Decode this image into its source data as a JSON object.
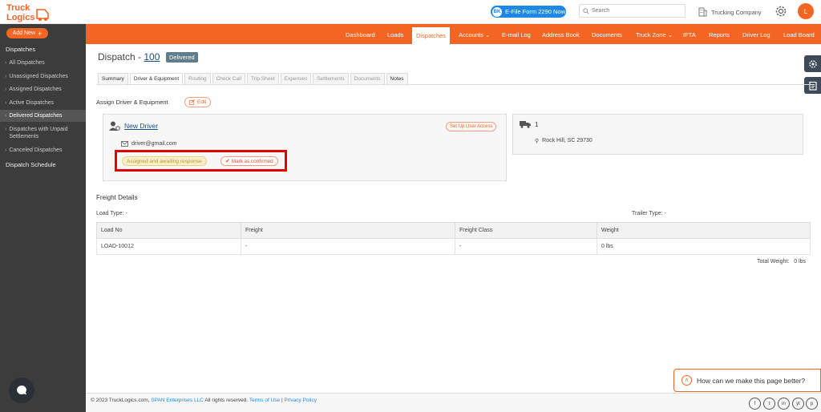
{
  "header": {
    "logo_text_1": "Truck",
    "logo_text_2": "Logics",
    "efile_badge": "BK",
    "efile_label": "E-File Form 2290 Now",
    "search_placeholder": "Search",
    "company_name": "Trucking Company",
    "avatar_initial": "L"
  },
  "sidebar": {
    "add_new": "Add New",
    "section": "Dispatches",
    "items": [
      {
        "label": "All Dispatches"
      },
      {
        "label": "Unassigned Dispatches"
      },
      {
        "label": "Assigned Dispatches"
      },
      {
        "label": "Active Dispatches"
      },
      {
        "label": "Delivered Dispatches"
      },
      {
        "label": "Dispatches with Unpaid Settlements"
      },
      {
        "label": "Canceled Dispatches"
      }
    ],
    "schedule": "Dispatch Schedule"
  },
  "nav": [
    {
      "label": "Dashboard"
    },
    {
      "label": "Loads"
    },
    {
      "label": "Dispatches"
    },
    {
      "label": "Accounts"
    },
    {
      "label": "E-mail Log"
    },
    {
      "label": "Address Book"
    },
    {
      "label": "Documents"
    },
    {
      "label": "Truck Zone"
    },
    {
      "label": "IFTA"
    },
    {
      "label": "Reports"
    },
    {
      "label": "Driver Log"
    },
    {
      "label": "Load Board"
    }
  ],
  "page": {
    "title_prefix": "Dispatch - ",
    "dispatch_number": "100",
    "status": "Delivered"
  },
  "tabs": [
    {
      "label": "Summary"
    },
    {
      "label": "Driver & Equipment"
    },
    {
      "label": "Routing"
    },
    {
      "label": "Check Call"
    },
    {
      "label": "Trip Sheet"
    },
    {
      "label": "Expenses"
    },
    {
      "label": "Settlements"
    },
    {
      "label": "Documents"
    },
    {
      "label": "Notes"
    }
  ],
  "assign": {
    "heading": "Assign Driver & Equipment",
    "edit": "Edit",
    "driver_name": "New Driver",
    "setup_access": "Set Up User Access",
    "email": "driver@gmail.com",
    "status_badge": "Assigned and awaiting response",
    "confirm_button": "Mark as confirmed",
    "truck_number": "1",
    "location": "Rock Hill, SC 29730"
  },
  "freight": {
    "heading": "Freight Details",
    "load_type": "Load Type: -",
    "trailer_type": "Trailer Type: -",
    "columns": [
      "Load No",
      "Freight",
      "Freight Class",
      "Weight"
    ],
    "rows": [
      [
        "LOAD-10012",
        "-",
        "-",
        "0 lbs"
      ]
    ],
    "total_weight_label": "Total Weight:",
    "total_weight_value": "0 lbs"
  },
  "footer": {
    "copyright": "© 2023 TruckLogics.com,",
    "span_link": "SPAN Enterprises LLC",
    "rights": " All rights reserved.",
    "terms": "Terms of Use",
    "separator": " | ",
    "privacy": "Privacy Policy",
    "social": [
      "f",
      "t",
      "in",
      "yt",
      "p"
    ]
  },
  "feedback": {
    "label": "How can we make this page better?"
  },
  "colors": {
    "brand_orange": "#f26522",
    "sidebar_bg": "#3c3c3c",
    "link_blue": "#1a4c8c",
    "highlight_red": "#e30000"
  }
}
